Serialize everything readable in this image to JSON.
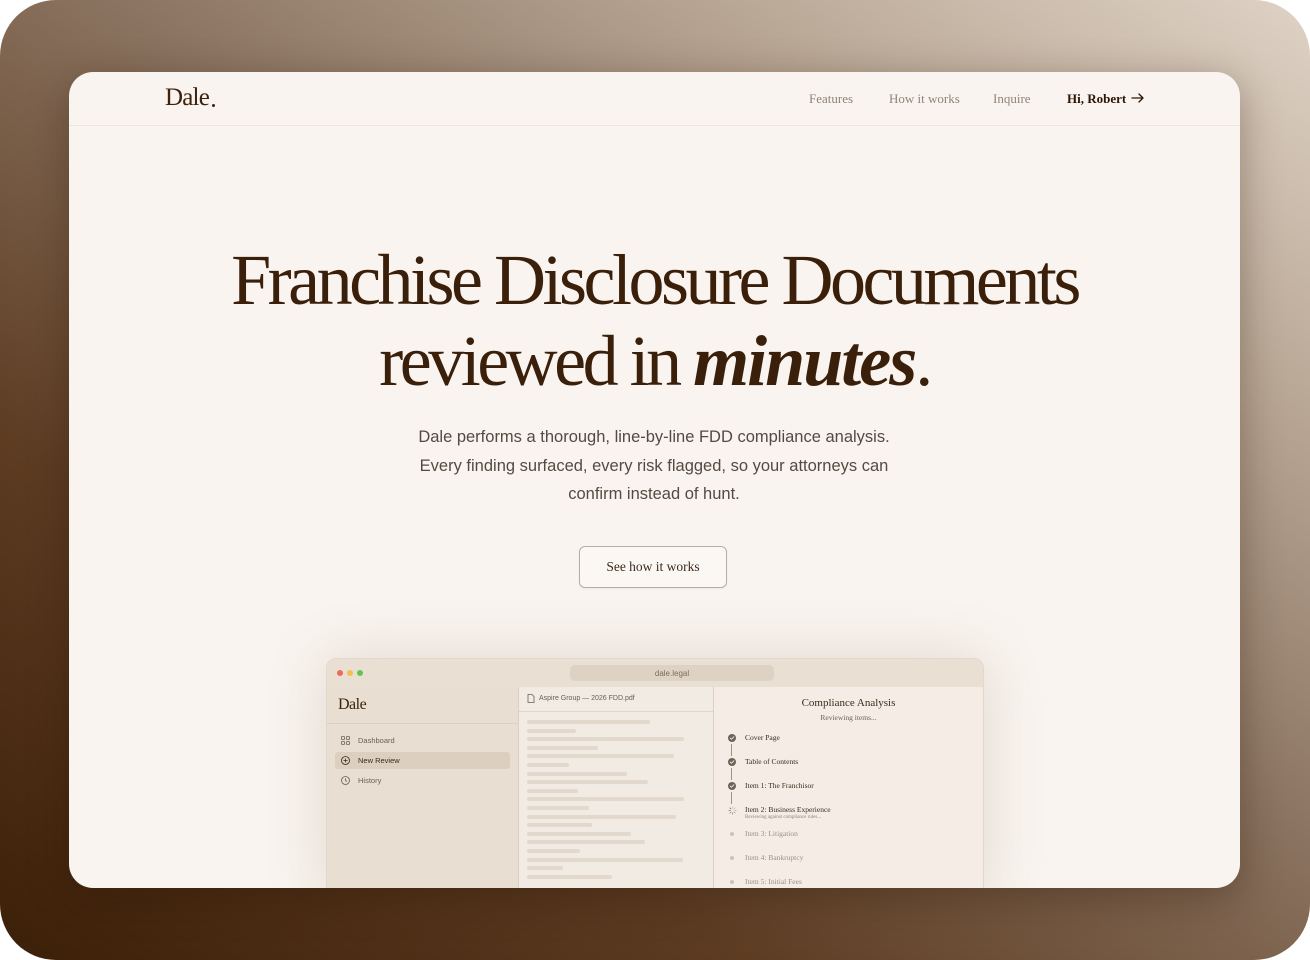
{
  "brand": {
    "name": "Dale"
  },
  "nav": {
    "links": [
      "Features",
      "How it works",
      "Inquire"
    ],
    "user_greeting": "Hi, Robert"
  },
  "hero": {
    "title_line1": "Franchise Disclosure Documents",
    "title_line2_prefix": "reviewed in ",
    "title_line2_emphasis": "minutes",
    "title_line2_suffix": ".",
    "subtitle": "Dale performs a thorough, line-by-line FDD compliance analysis. Every finding surfaced, every risk flagged, so your attorneys can confirm instead of hunt.",
    "cta_label": "See how it works"
  },
  "app_preview": {
    "url": "dale.legal",
    "logo": "Dale",
    "sidebar_items": [
      {
        "label": "Dashboard",
        "icon": "grid-icon",
        "active": false
      },
      {
        "label": "New Review",
        "icon": "plus-circle-icon",
        "active": true
      },
      {
        "label": "History",
        "icon": "clock-icon",
        "active": false
      }
    ],
    "document_name": "Aspire Group — 2026 FDD.pdf",
    "panel_title": "Compliance Analysis",
    "panel_subtitle": "Reviewing items...",
    "steps": [
      {
        "label": "Cover Page",
        "status": "done"
      },
      {
        "label": "Table of Contents",
        "status": "done"
      },
      {
        "label": "Item 1: The Franchisor",
        "status": "done"
      },
      {
        "label": "Item 2: Business Experience",
        "status": "in-progress",
        "detail": "Reviewing against compliance rules..."
      },
      {
        "label": "Item 3: Litigation",
        "status": "pending"
      },
      {
        "label": "Item 4: Bankruptcy",
        "status": "pending"
      },
      {
        "label": "Item 5: Initial Fees",
        "status": "pending"
      }
    ]
  },
  "colors": {
    "brand_brown": "#3a1f0a",
    "page_background": "#f9f4ef",
    "muted_text": "#8f8378"
  }
}
